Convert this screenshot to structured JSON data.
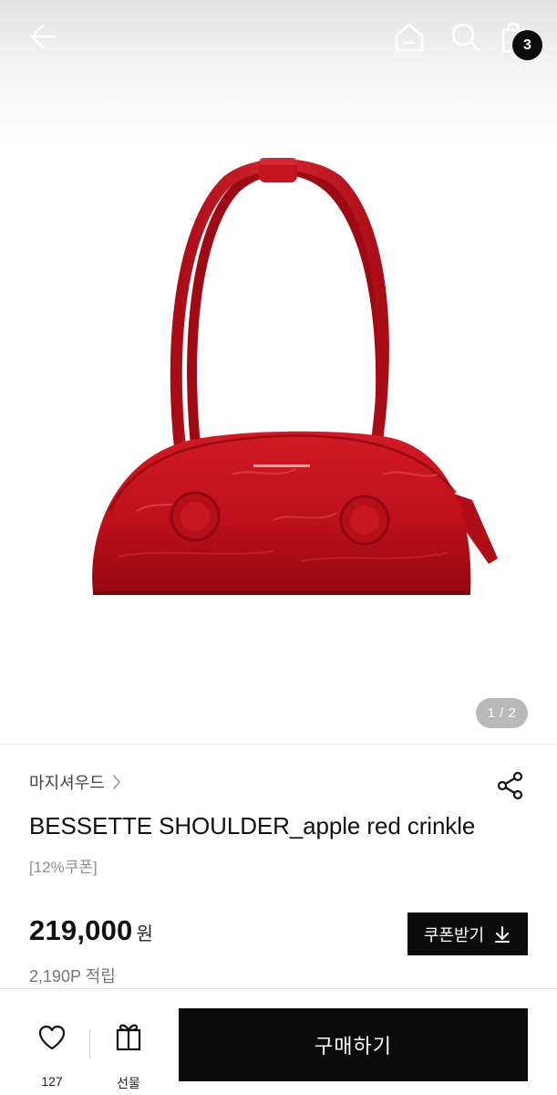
{
  "header": {
    "back_icon": "arrow-left-icon",
    "home_icon": "home-icon",
    "search_icon": "search-icon",
    "cart_icon": "shopping-bag-icon",
    "cart_count": "3"
  },
  "gallery": {
    "pager": "1 / 2",
    "image_subject": "red crinkle leather shoulder bag"
  },
  "product": {
    "brand": "마지셔우드",
    "title": "BESSETTE SHOULDER_apple red crinkle",
    "coupon_tag": "[12%쿠폰]",
    "price": "219,000",
    "price_unit": "원",
    "coupon_button": "쿠폰받기",
    "points": "2,190P 적립"
  },
  "bottom_bar": {
    "like_count": "127",
    "gift_label": "선물",
    "buy_label": "구매하기"
  },
  "colors": {
    "accent": "#0b0b0b",
    "bag_red": "#c0121c",
    "muted_text": "#8f8f8f"
  }
}
